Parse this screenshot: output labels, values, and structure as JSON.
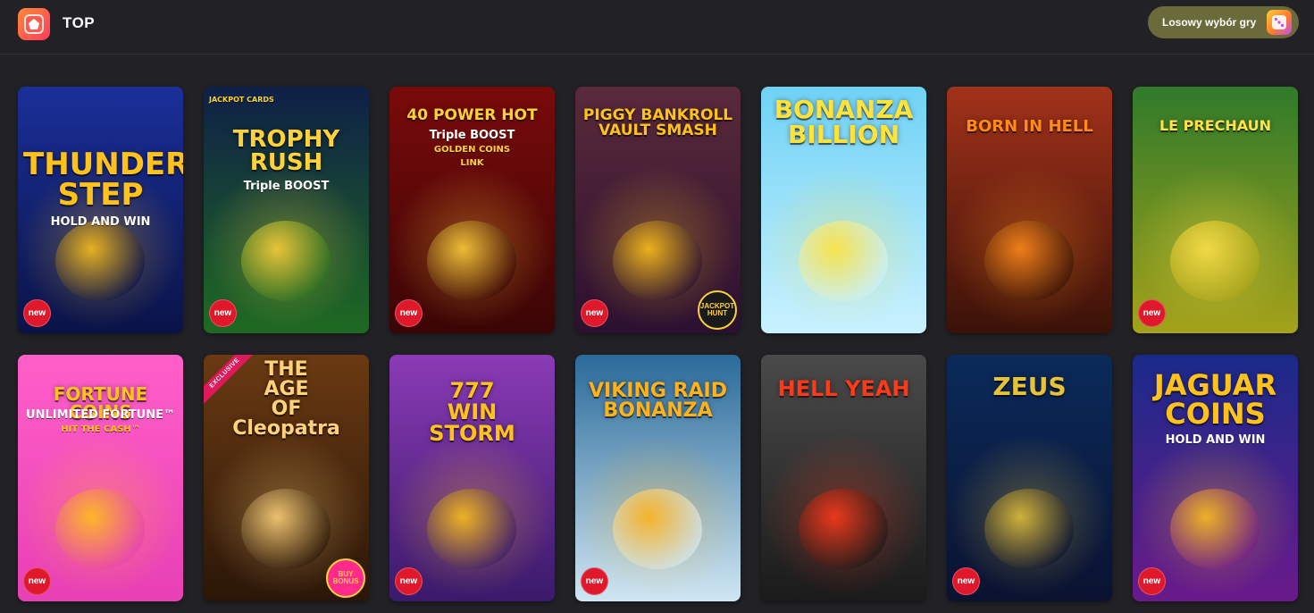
{
  "header": {
    "section_title": "TOP",
    "random_button_label": "Losowy wybór gry",
    "icons": {
      "logo": "top-section-logo-icon",
      "random": "dice-icon"
    }
  },
  "badges": {
    "new": "new"
  },
  "games": [
    {
      "title": "THUNDER\nSTEP",
      "subtitle": "HOLD AND WIN",
      "new": true,
      "colors": [
        "#1a2f9a",
        "#0a1347"
      ],
      "accent": "#ffc21a"
    },
    {
      "title": "TROPHY\nRUSH",
      "subtitle": "Triple BOOST",
      "top_label": "JACKPOT CARDS",
      "new": true,
      "colors": [
        "#0e1f47",
        "#1f6a22"
      ],
      "accent": "#ffd23a"
    },
    {
      "title": "40 POWER HOT",
      "subtitle": "Triple BOOST",
      "subtitle2": "GOLDEN COINS",
      "subtitle3": "LINK",
      "new": true,
      "colors": [
        "#7a0a0a",
        "#3a0505"
      ],
      "accent": "#ffd23a"
    },
    {
      "title": "PIGGY BANKROLL\nVAULT SMASH",
      "corner": "JACKPOT HUNT",
      "new": true,
      "colors": [
        "#5a2a3a",
        "#2b1030"
      ],
      "accent": "#ffc21a"
    },
    {
      "title": "BONANZA\nBILLION",
      "new": false,
      "colors": [
        "#6fd2f5",
        "#c9f1ff"
      ],
      "accent": "#ffe23a"
    },
    {
      "title": "BORN IN HELL",
      "new": false,
      "colors": [
        "#a2321a",
        "#3a1208"
      ],
      "accent": "#ff8a1a"
    },
    {
      "title": "LE PRECHAUN",
      "new": true,
      "colors": [
        "#2f7a2a",
        "#a4a21a"
      ],
      "accent": "#ffe14a"
    },
    {
      "title": "FORTUNE COINS",
      "subtitle": "UNLIMITED FORTUNE™",
      "subtitle2": "HIT THE CASH™",
      "new": true,
      "colors": [
        "#ff5fc9",
        "#e83fb5"
      ],
      "accent": "#ffc21a"
    },
    {
      "title": "THE\nAGE\nOF\nCleopatra",
      "ribbon": "EXCLUSIVE",
      "corner": "BUY BONUS",
      "new": false,
      "colors": [
        "#6a3a12",
        "#2a1608"
      ],
      "accent": "#ffd27a"
    },
    {
      "title": "777\nWIN\nSTORM",
      "new": true,
      "colors": [
        "#8a3ab5",
        "#3a1a6a"
      ],
      "accent": "#ffc21a"
    },
    {
      "title": "VIKING RAID\nBONANZA",
      "new": true,
      "colors": [
        "#2a6a9a",
        "#cfe6f2"
      ],
      "accent": "#ffb21a"
    },
    {
      "title": "HELL YEAH",
      "new": false,
      "colors": [
        "#4a4a4a",
        "#1a1a1a"
      ],
      "accent": "#ff3a1a"
    },
    {
      "title": "ZEUS",
      "new": true,
      "colors": [
        "#0a2a5a",
        "#0a1230"
      ],
      "accent": "#e6c23a"
    },
    {
      "title": "JAGUAR\nCOINS",
      "subtitle": "HOLD AND WIN",
      "new": true,
      "colors": [
        "#1a2a8a",
        "#6a1a8a"
      ],
      "accent": "#ffc21a"
    }
  ]
}
